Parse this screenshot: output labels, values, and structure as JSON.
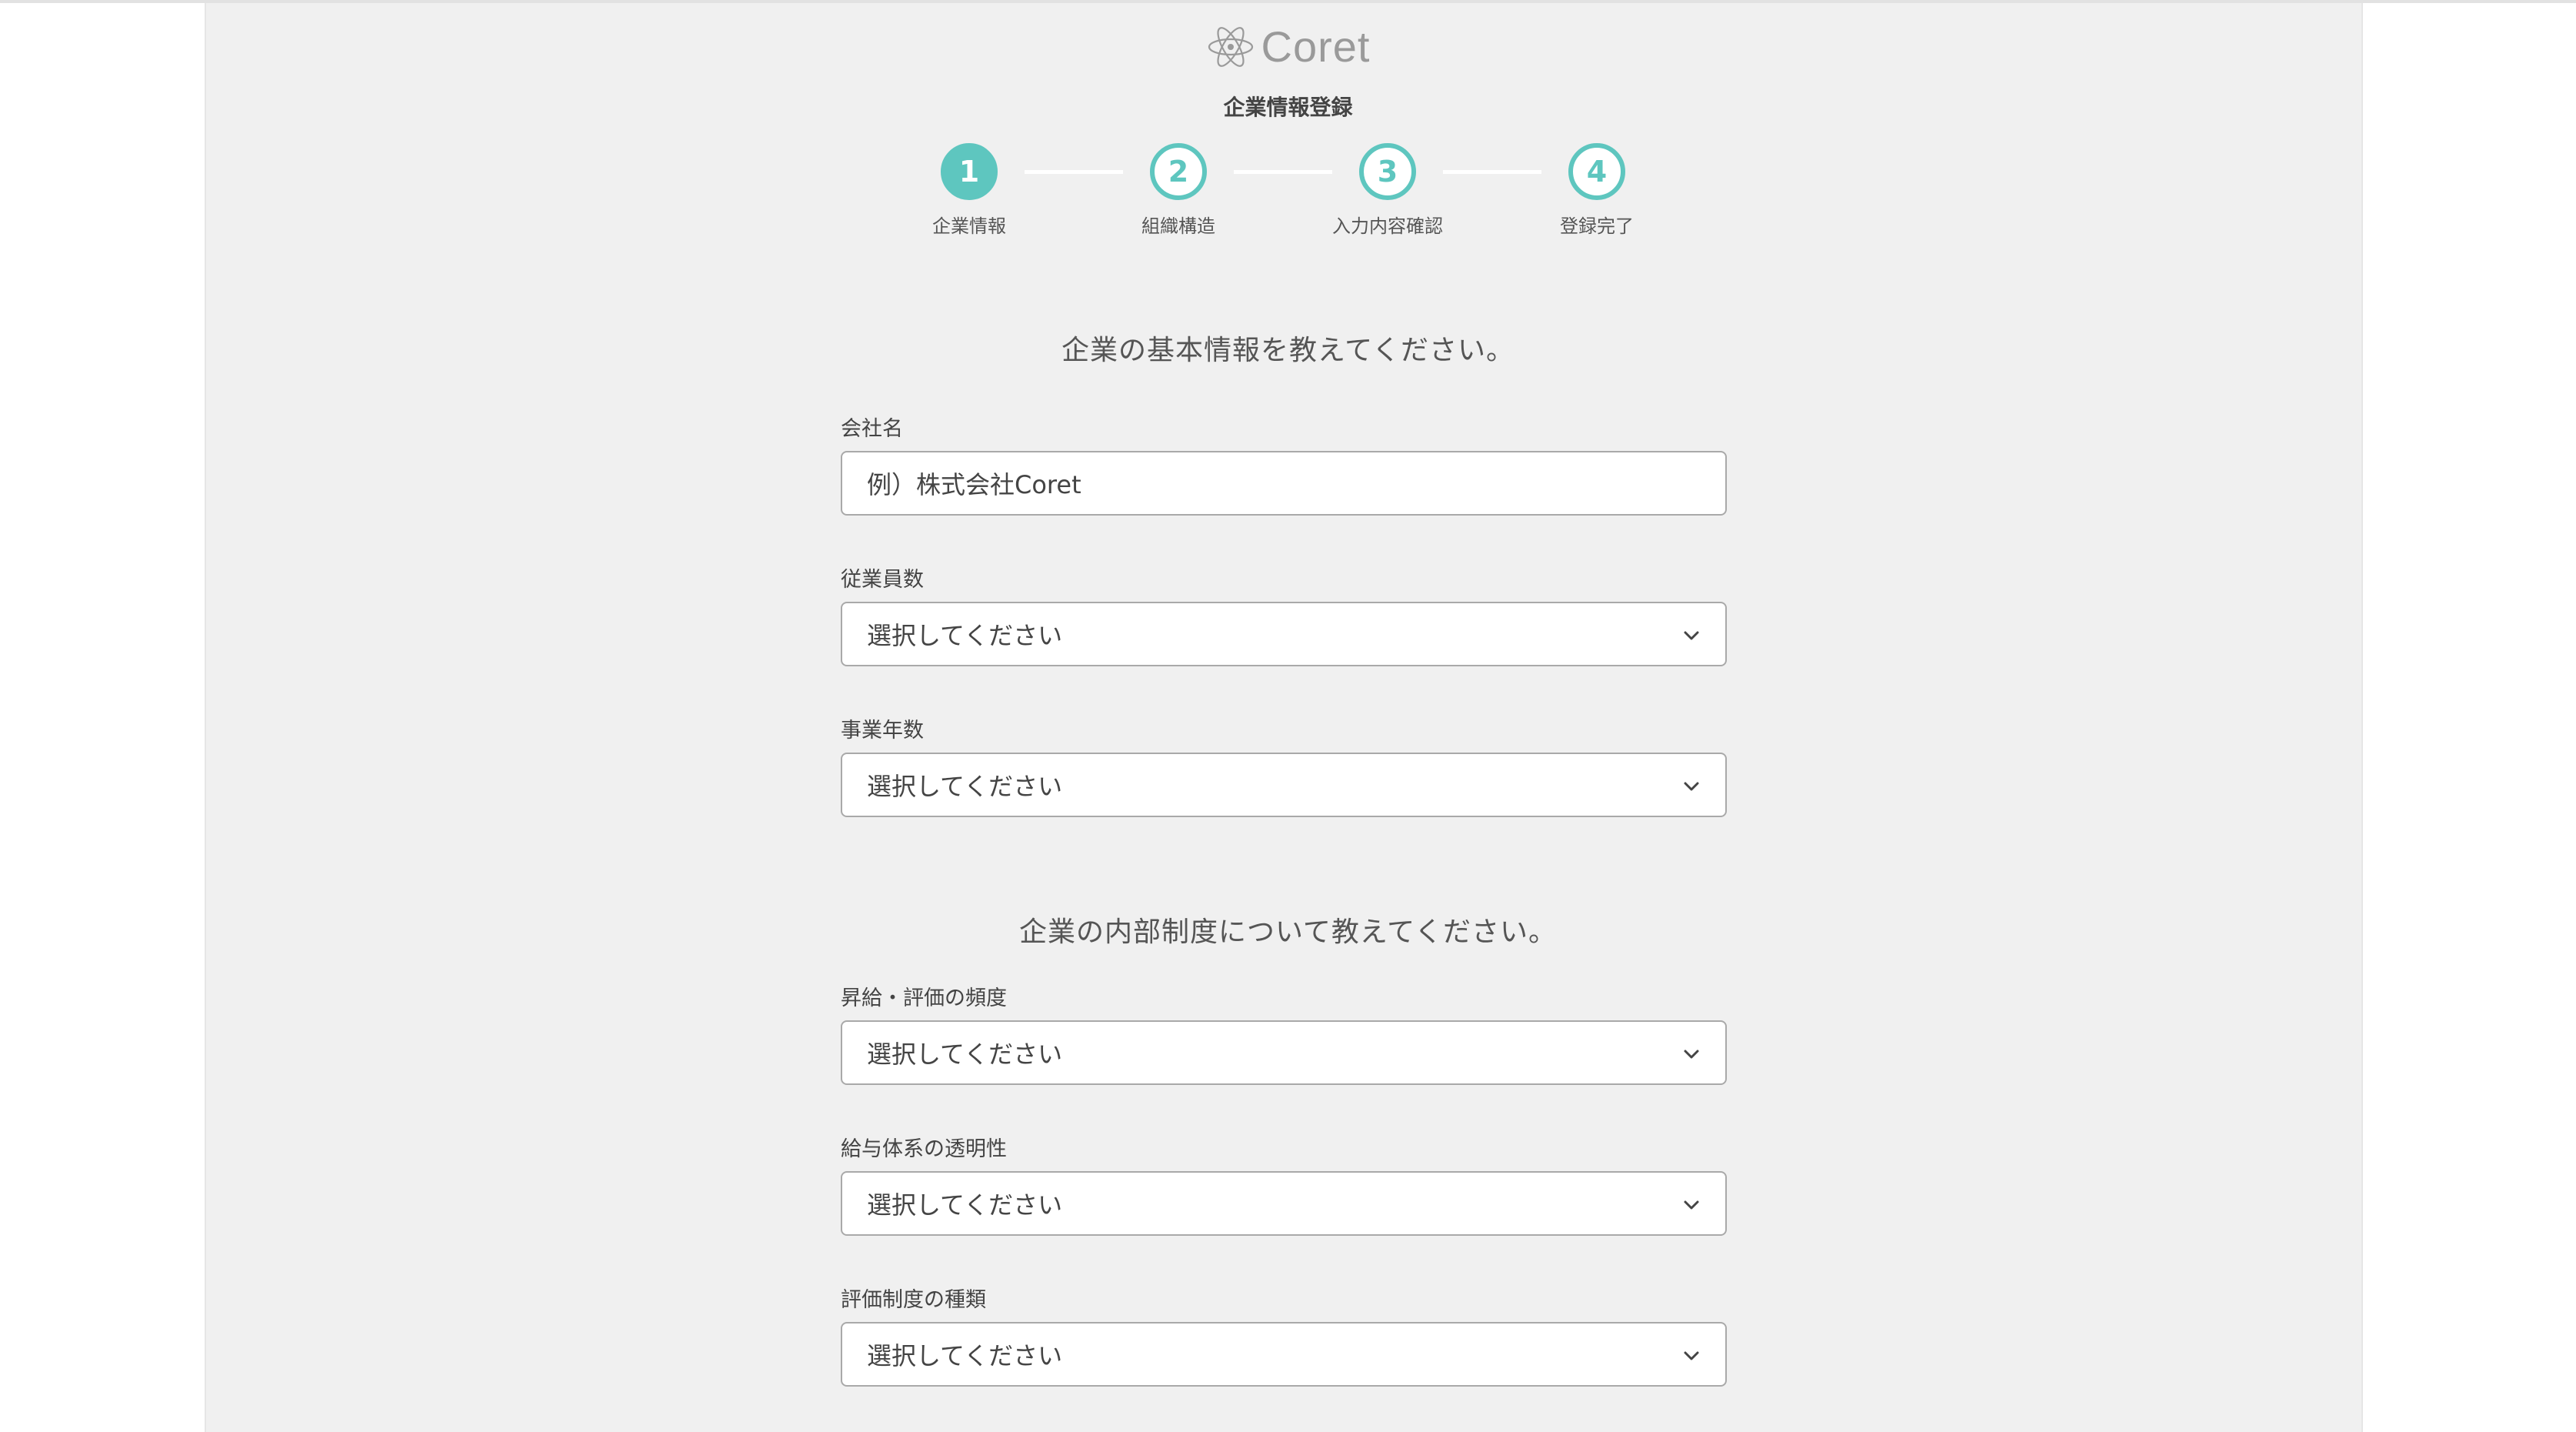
{
  "brand": {
    "name": "Coret",
    "logo_icon": "atom-icon"
  },
  "page_title": "企業情報登録",
  "accent_color": "#5ec6bf",
  "steps": [
    {
      "number": "1",
      "label": "企業情報"
    },
    {
      "number": "2",
      "label": "組織構造"
    },
    {
      "number": "3",
      "label": "入力内容確認"
    },
    {
      "number": "4",
      "label": "登録完了"
    }
  ],
  "current_step": 1,
  "section_basic": {
    "title": "企業の基本情報を教えてください。",
    "company_name": {
      "label": "会社名",
      "placeholder": "例）株式会社Coret"
    },
    "employees": {
      "label": "従業員数",
      "selected": "選択してください"
    },
    "years": {
      "label": "事業年数",
      "selected": "選択してください"
    }
  },
  "section_internal": {
    "title": "企業の内部制度について教えてください。",
    "raise_frequency": {
      "label": "昇給・評価の頻度",
      "selected": "選択してください"
    },
    "pay_transparency": {
      "label": "給与体系の透明性",
      "selected": "選択してください"
    },
    "evaluation_type": {
      "label": "評価制度の種類",
      "selected": "選択してください"
    }
  }
}
